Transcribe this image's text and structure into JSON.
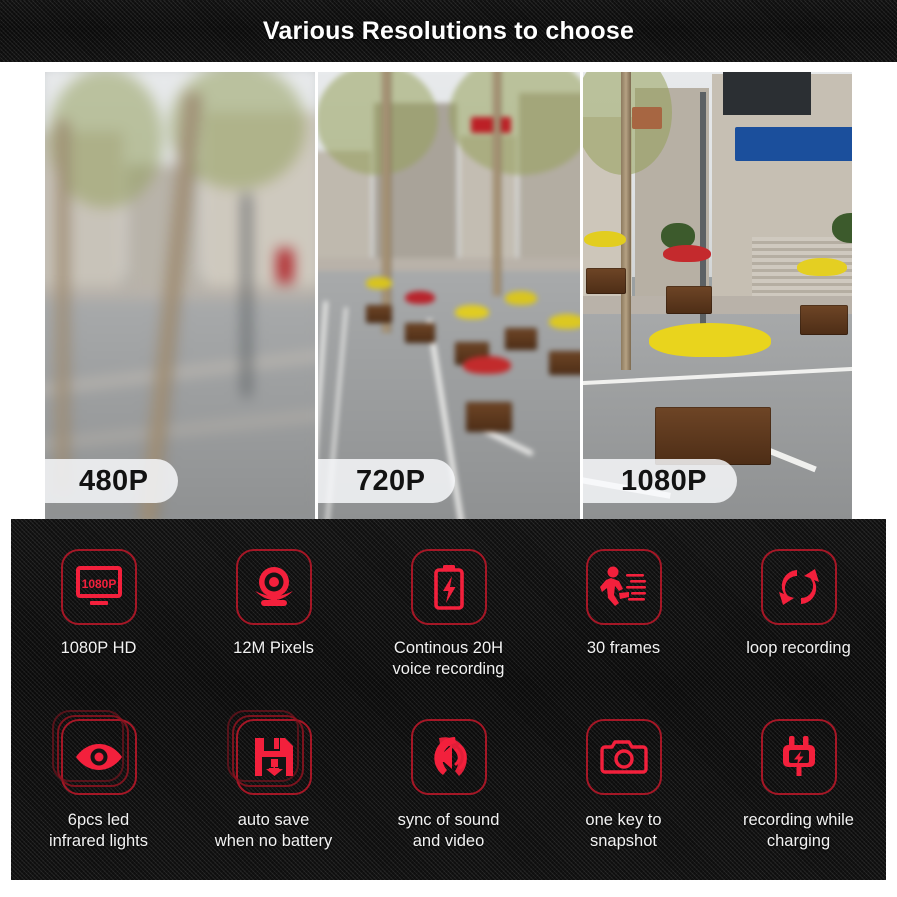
{
  "header": {
    "title": "Various Resolutions to choose"
  },
  "accent": {
    "red": "#f3203c",
    "red_dark": "#a51726",
    "panel": "#141414",
    "text": "#f2f2f2"
  },
  "comparison": {
    "panes": [
      {
        "id": "pane-480",
        "label": "480P",
        "quality": "heavily-blurred"
      },
      {
        "id": "pane-720",
        "label": "720P",
        "quality": "moderately-blurred"
      },
      {
        "id": "pane-1080",
        "label": "1080P",
        "quality": "sharp"
      }
    ]
  },
  "features": {
    "row1": [
      {
        "icon": "monitor-1080p-icon",
        "label": "1080P HD",
        "screen_text": "1080P"
      },
      {
        "icon": "webcam-icon",
        "label": "12M Pixels"
      },
      {
        "icon": "battery-bolt-icon",
        "label": "Continous 20H\nvoice recording"
      },
      {
        "icon": "running-man-icon",
        "label": "30 frames"
      },
      {
        "icon": "loop-arrows-icon",
        "label": "loop recording"
      }
    ],
    "row2": [
      {
        "icon": "eye-icon",
        "label": "6pcs led\ninfrared lights"
      },
      {
        "icon": "floppy-save-icon",
        "label": "auto save\nwhen no battery"
      },
      {
        "icon": "speaker-waves-icon",
        "label": "sync of sound\nand video"
      },
      {
        "icon": "camera-icon",
        "label": "one key to\nsnapshot"
      },
      {
        "icon": "power-plug-icon",
        "label": "recording while\ncharging"
      }
    ]
  }
}
